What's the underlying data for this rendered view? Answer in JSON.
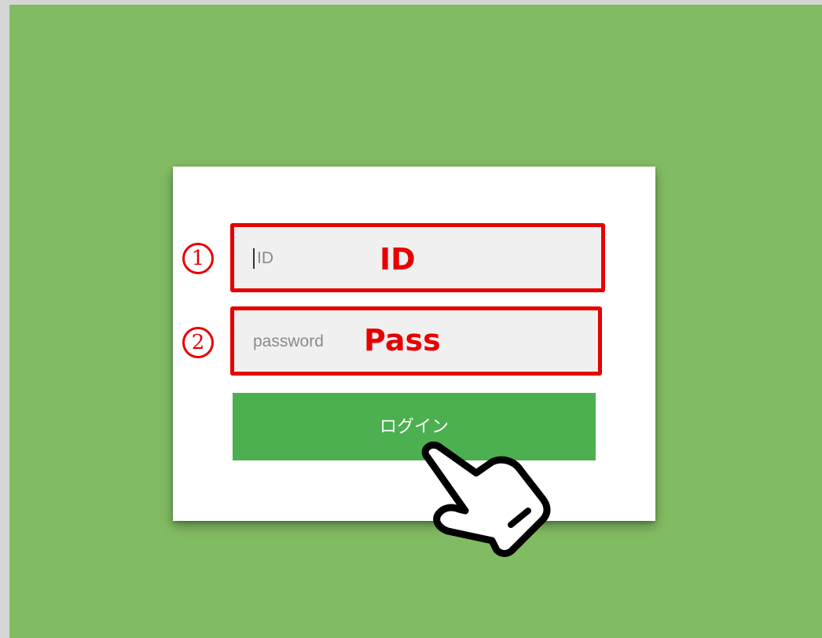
{
  "form": {
    "id_placeholder": "ID",
    "password_placeholder": "password",
    "login_label": "ログイン"
  },
  "annotations": {
    "step1_marker": "①",
    "step2_marker": "②",
    "id_label": "ID",
    "pass_label": "Pass",
    "highlight_color": "#e60000"
  },
  "colors": {
    "background": "#82bc62",
    "button": "#4caf50",
    "field": "#f0f0f0"
  },
  "icons": {
    "pointer": "pointing-hand-icon"
  }
}
